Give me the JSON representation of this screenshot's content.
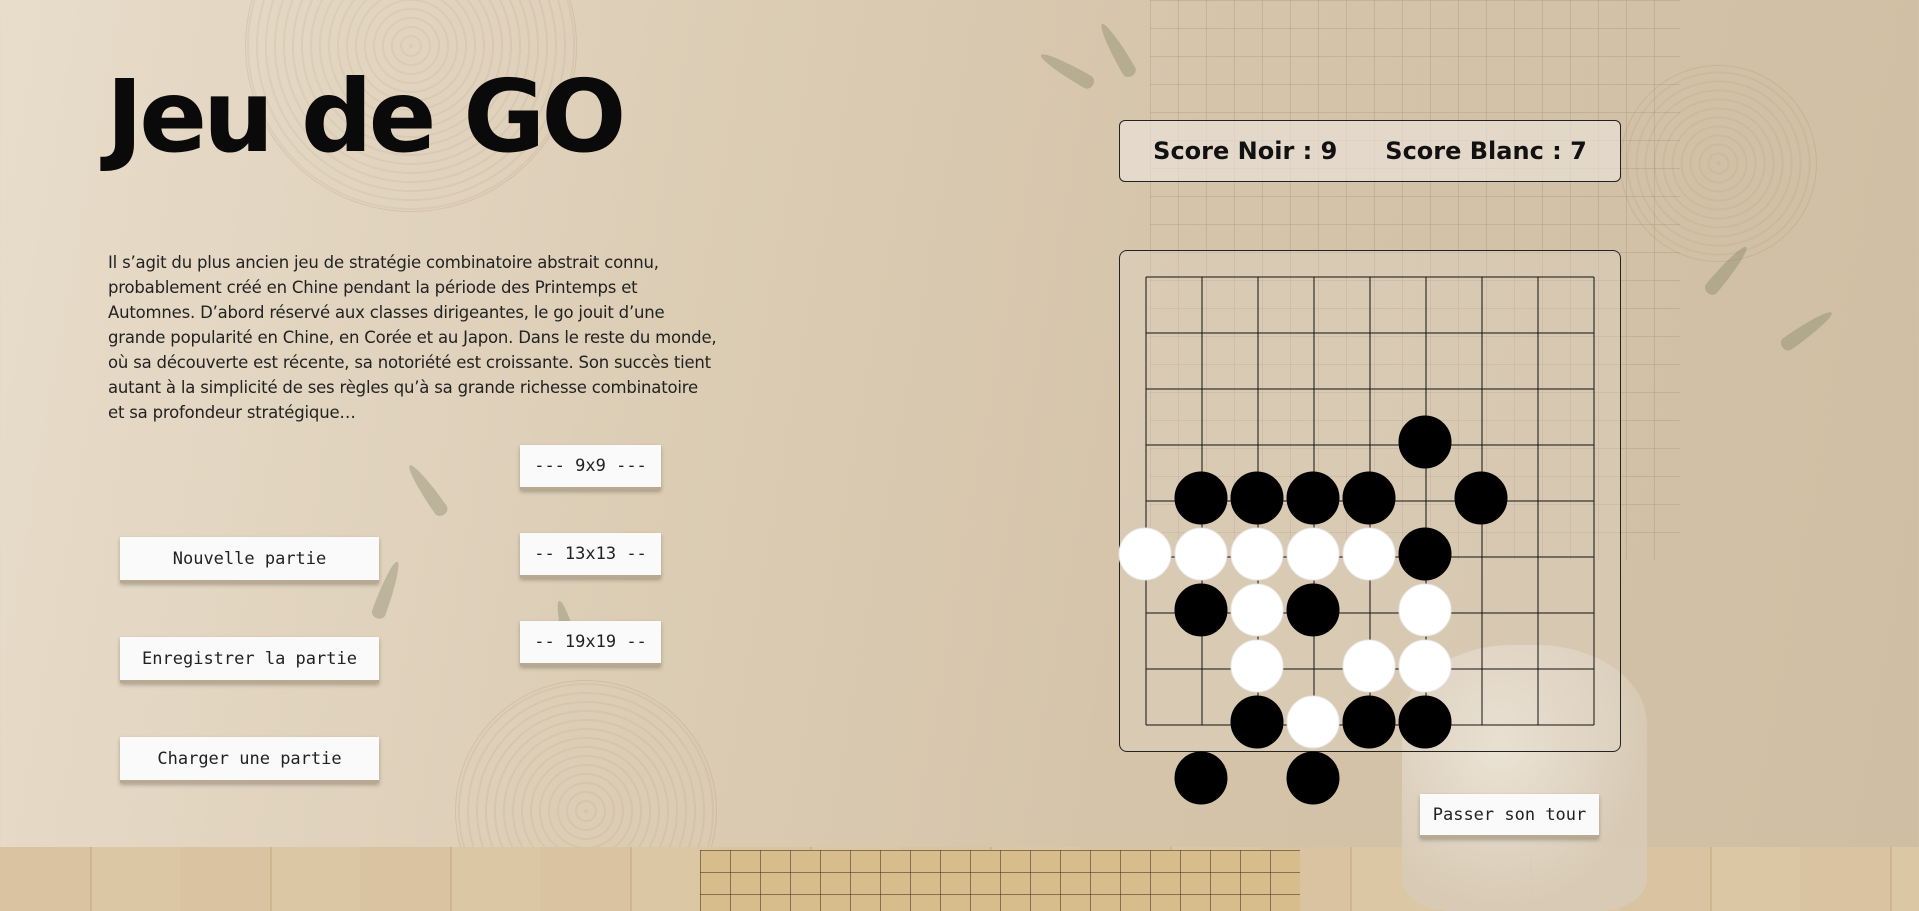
{
  "title": "Jeu de GO",
  "description": "Il s’agit du plus ancien jeu de stratégie combinatoire abstrait connu, probablement créé en Chine pendant la période des Printemps et Automnes. D’abord réservé aux classes dirigeantes, le go jouit d’une grande popularité en Chine, en Corée et au Japon. Dans le reste du monde, où sa découverte est récente, sa notoriété est croissante. Son succès tient autant à la simplicité de ses règles qu’à sa grande richesse combinatoire et sa profondeur stratégique…",
  "buttons": {
    "new_game": "Nouvelle partie",
    "save_game": "Enregistrer la partie",
    "load_game": "Charger une partie",
    "size_9": "--- 9x9 ---",
    "size_13": "-- 13x13 --",
    "size_19": "-- 19x19 --",
    "pass_turn": "Passer son tour"
  },
  "score": {
    "black": "Score Noir : 9",
    "white": "Score Blanc : 7"
  },
  "board": {
    "size": 9,
    "stones": [
      {
        "col": 5,
        "row": 2,
        "color": "black"
      },
      {
        "col": 1,
        "row": 3,
        "color": "black"
      },
      {
        "col": 2,
        "row": 3,
        "color": "black"
      },
      {
        "col": 3,
        "row": 3,
        "color": "black"
      },
      {
        "col": 4,
        "row": 3,
        "color": "black"
      },
      {
        "col": 6,
        "row": 3,
        "color": "black"
      },
      {
        "col": 0,
        "row": 4,
        "color": "white"
      },
      {
        "col": 1,
        "row": 4,
        "color": "white"
      },
      {
        "col": 2,
        "row": 4,
        "color": "white"
      },
      {
        "col": 3,
        "row": 4,
        "color": "white"
      },
      {
        "col": 4,
        "row": 4,
        "color": "white"
      },
      {
        "col": 5,
        "row": 4,
        "color": "black"
      },
      {
        "col": 1,
        "row": 5,
        "color": "black"
      },
      {
        "col": 2,
        "row": 5,
        "color": "white"
      },
      {
        "col": 3,
        "row": 5,
        "color": "black"
      },
      {
        "col": 5,
        "row": 5,
        "color": "white"
      },
      {
        "col": 2,
        "row": 6,
        "color": "white"
      },
      {
        "col": 4,
        "row": 6,
        "color": "white"
      },
      {
        "col": 5,
        "row": 6,
        "color": "white"
      },
      {
        "col": 2,
        "row": 7,
        "color": "black"
      },
      {
        "col": 3,
        "row": 7,
        "color": "white"
      },
      {
        "col": 4,
        "row": 7,
        "color": "black"
      },
      {
        "col": 5,
        "row": 7,
        "color": "black"
      },
      {
        "col": 1,
        "row": 8,
        "color": "black"
      },
      {
        "col": 3,
        "row": 8,
        "color": "black"
      }
    ]
  }
}
